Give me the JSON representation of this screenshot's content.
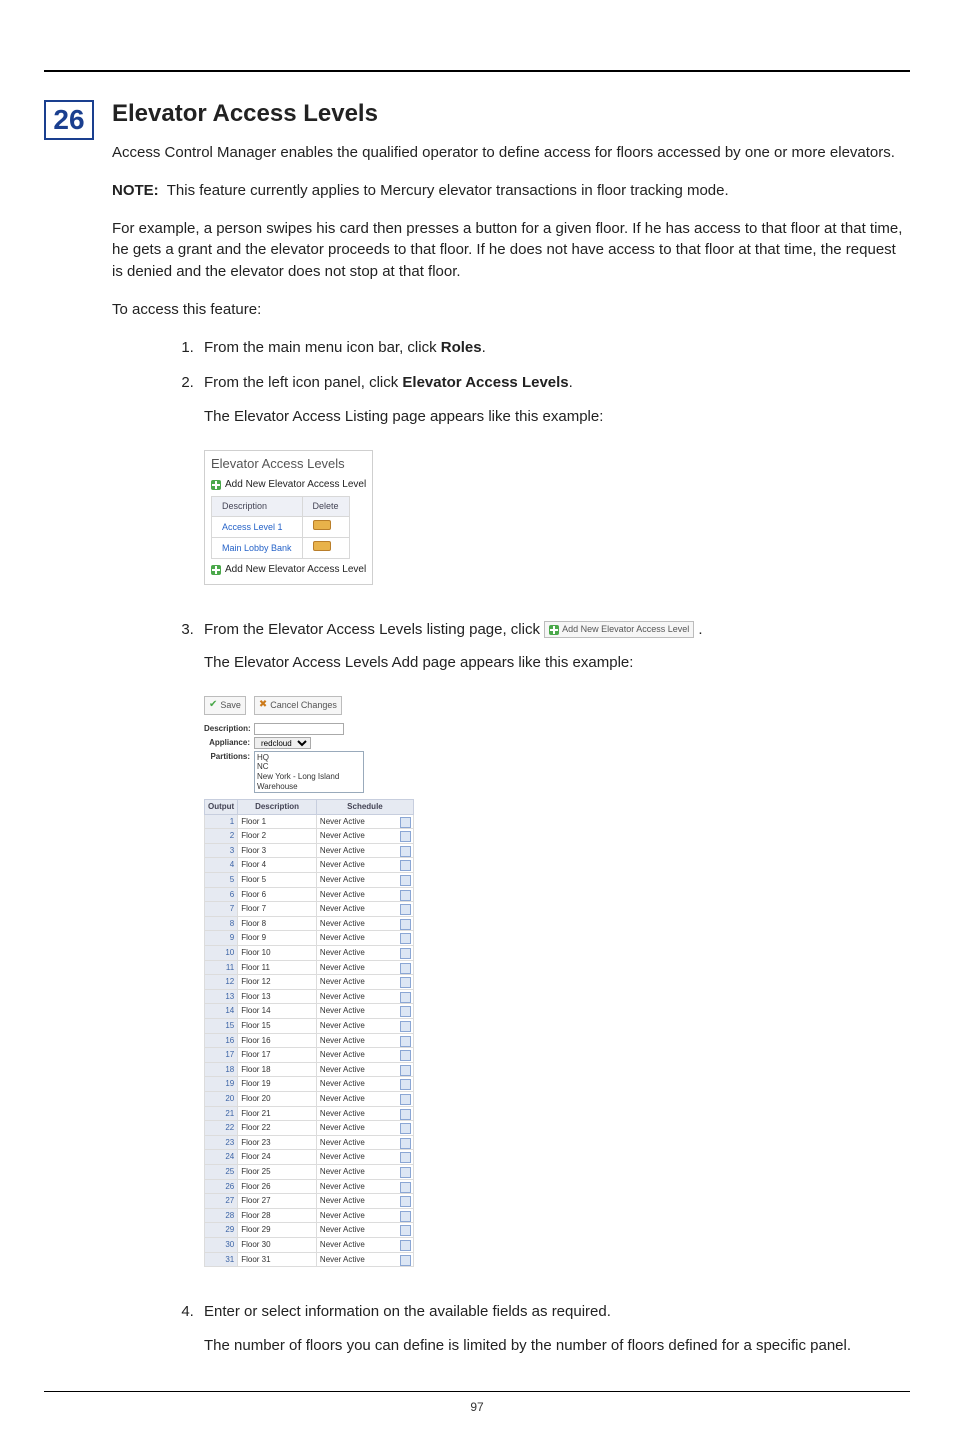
{
  "chapter_number": "26",
  "title": "Elevator Access Levels",
  "intro": "Access Control Manager enables the qualified operator to define access for floors accessed by one or more elevators.",
  "note_label": "NOTE:",
  "note_text": "This feature currently applies to Mercury elevator transactions in floor tracking mode.",
  "example_para": "For example, a person swipes his card then presses a button for a given floor. If he has access to that floor at that time, he gets a grant and the elevator proceeds to that floor. If he does not have access to that floor at that time, the request is denied and the elevator does not stop at that floor.",
  "to_access": "To access this feature:",
  "steps": {
    "s1_pre": "From the main menu icon bar, click ",
    "s1_bold": "Roles",
    "s1_post": ".",
    "s2_pre": "From the left icon panel, click ",
    "s2_bold": "Elevator Access Levels",
    "s2_post": ".",
    "s2_sub": "The Elevator Access Listing page appears like this example:",
    "s3_pre": "From the Elevator Access Levels listing page, click ",
    "s3_post": ".",
    "s3_sub": "The Elevator Access Levels Add page appears like this example:",
    "s4": "Enter or select information on the available fields as required.",
    "s4_sub": "The number of floors you can define is limited by the number of floors defined for a specific panel."
  },
  "fig1": {
    "title": "Elevator Access Levels",
    "add_label": "Add New Elevator Access Level",
    "th_desc": "Description",
    "th_del": "Delete",
    "rows": [
      {
        "desc": "Access Level 1"
      },
      {
        "desc": "Main Lobby Bank"
      }
    ]
  },
  "inline_btn_label": "Add New Elevator Access Level",
  "fig2": {
    "save": "Save",
    "cancel": "Cancel Changes",
    "lbl_desc": "Description:",
    "lbl_app": "Appliance:",
    "app_value": "redcloud",
    "lbl_part": "Partitions:",
    "partitions": [
      "HQ",
      "NC",
      "New York - Long Island Warehouse"
    ],
    "th_output": "Output",
    "th_desc": "Description",
    "th_sched": "Schedule",
    "schedule": "Never Active",
    "floor_prefix": "Floor ",
    "floor_count": 31
  },
  "page_number": "97"
}
